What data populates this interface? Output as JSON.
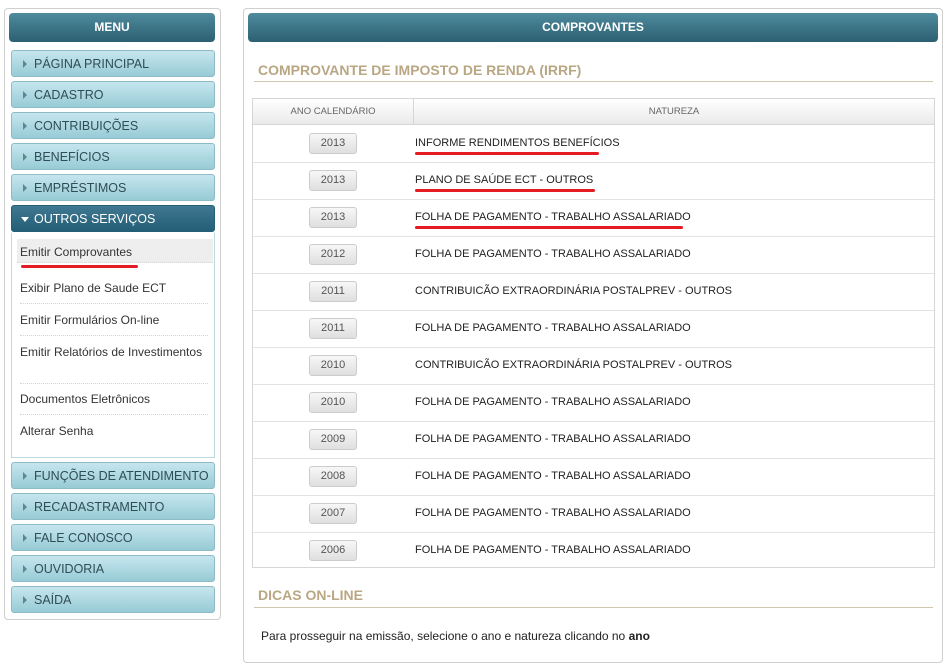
{
  "sidebar": {
    "title": "MENU",
    "items": [
      {
        "label": "PÁGINA PRINCIPAL"
      },
      {
        "label": "CADASTRO"
      },
      {
        "label": "CONTRIBUIÇÕES"
      },
      {
        "label": "BENEFÍCIOS"
      },
      {
        "label": "EMPRÉSTIMOS"
      },
      {
        "label": "OUTROS SERVIÇOS"
      }
    ],
    "submenu": [
      {
        "label": "Emitir Comprovantes"
      },
      {
        "label": "Exibir Plano de Saude ECT"
      },
      {
        "label": "Emitir Formulários On-line"
      },
      {
        "label": "Emitir Relatórios de Investimentos"
      },
      {
        "label": "Documentos Eletrônicos"
      },
      {
        "label": "Alterar Senha"
      }
    ],
    "items_after": [
      {
        "label": "FUNÇÕES DE ATENDIMENTO"
      },
      {
        "label": "RECADASTRAMENTO"
      },
      {
        "label": "FALE CONOSCO"
      },
      {
        "label": "OUVIDORIA"
      },
      {
        "label": "SAÍDA"
      }
    ]
  },
  "main": {
    "title": "COMPROVANTES",
    "section_title": "COMPROVANTE DE IMPOSTO DE RENDA (IRRF)",
    "table": {
      "col_year": "ANO CALENDÁRIO",
      "col_nature": "NATUREZA",
      "rows": [
        {
          "year": "2013",
          "nature": "INFORME RENDIMENTOS BENEFÍCIOS"
        },
        {
          "year": "2013",
          "nature": "PLANO DE SAÚDE ECT - OUTROS"
        },
        {
          "year": "2013",
          "nature": "FOLHA DE PAGAMENTO - TRABALHO ASSALARIADO"
        },
        {
          "year": "2012",
          "nature": "FOLHA DE PAGAMENTO - TRABALHO ASSALARIADO"
        },
        {
          "year": "2011",
          "nature": "CONTRIBUICÃO EXTRAORDINÁRIA POSTALPREV - OUTROS"
        },
        {
          "year": "2011",
          "nature": "FOLHA DE PAGAMENTO - TRABALHO ASSALARIADO"
        },
        {
          "year": "2010",
          "nature": "CONTRIBUICÃO EXTRAORDINÁRIA POSTALPREV - OUTROS"
        },
        {
          "year": "2010",
          "nature": "FOLHA DE PAGAMENTO - TRABALHO ASSALARIADO"
        },
        {
          "year": "2009",
          "nature": "FOLHA DE PAGAMENTO - TRABALHO ASSALARIADO"
        },
        {
          "year": "2008",
          "nature": "FOLHA DE PAGAMENTO - TRABALHO ASSALARIADO"
        },
        {
          "year": "2007",
          "nature": "FOLHA DE PAGAMENTO - TRABALHO ASSALARIADO"
        },
        {
          "year": "2006",
          "nature": "FOLHA DE PAGAMENTO - TRABALHO ASSALARIADO"
        }
      ]
    },
    "tips_title": "DICAS ON-LINE",
    "tips_text": "Para prosseguir na emissão, selecione o ano e natureza clicando no",
    "tips_bold": "ano"
  },
  "colors": {
    "header_teal": "#2c6072",
    "menu_button": "#97cbd6",
    "section_title": "#b9a783",
    "highlight_underline": "#e41b23"
  },
  "icons": {
    "menu_arrow": "caret-right-icon",
    "menu_open": "caret-down-icon"
  }
}
